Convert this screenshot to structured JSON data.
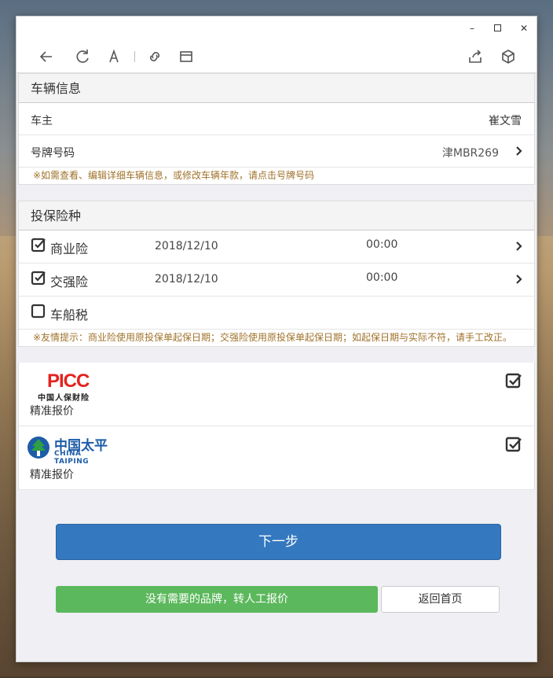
{
  "window": {
    "controls": {
      "minimize": "–",
      "maximize": "",
      "close": "✕"
    }
  },
  "toolbar": {
    "icons": [
      "back-icon",
      "refresh-icon",
      "text-size-icon",
      "link-icon",
      "window-icon",
      "share-icon",
      "cube-icon"
    ]
  },
  "vehicle_section": {
    "title": "车辆信息",
    "owner_label": "车主",
    "owner_value": "崔文雪",
    "plate_label": "号牌号码",
    "plate_value": "津MBR269",
    "hint": "※如需查看、编辑详细车辆信息，或修改车辆年款，请点击号牌号码"
  },
  "insurance_section": {
    "title": "投保险种",
    "items": [
      {
        "name": "商业险",
        "checked": true,
        "date": "2018/12/10",
        "time": "00:00"
      },
      {
        "name": "交强险",
        "checked": true,
        "date": "2018/12/10",
        "time": "00:00"
      },
      {
        "name": "车船税",
        "checked": false,
        "date": "",
        "time": ""
      }
    ],
    "hint": "※友情提示：商业险使用原投保单起保日期；交强险使用原投保单起保日期；如起保日期与实际不符，请手工改正。"
  },
  "companies": [
    {
      "logo_text": "PICC",
      "logo_sub": "中国人保财险",
      "tag": "精准报价",
      "checked": true
    },
    {
      "logo_text": "中国太平",
      "logo_sub": "CHINA TAIPING",
      "tag": "精准报价",
      "checked": true
    }
  ],
  "buttons": {
    "next": "下一步",
    "manual_quote": "没有需要的品牌，转人工报价",
    "home": "返回首页"
  },
  "colors": {
    "primary": "#3478bf",
    "success": "#5cb85c",
    "hint_text": "#a0722a",
    "picc_red": "#e3231f",
    "taiping_blue": "#1d5ca8"
  }
}
